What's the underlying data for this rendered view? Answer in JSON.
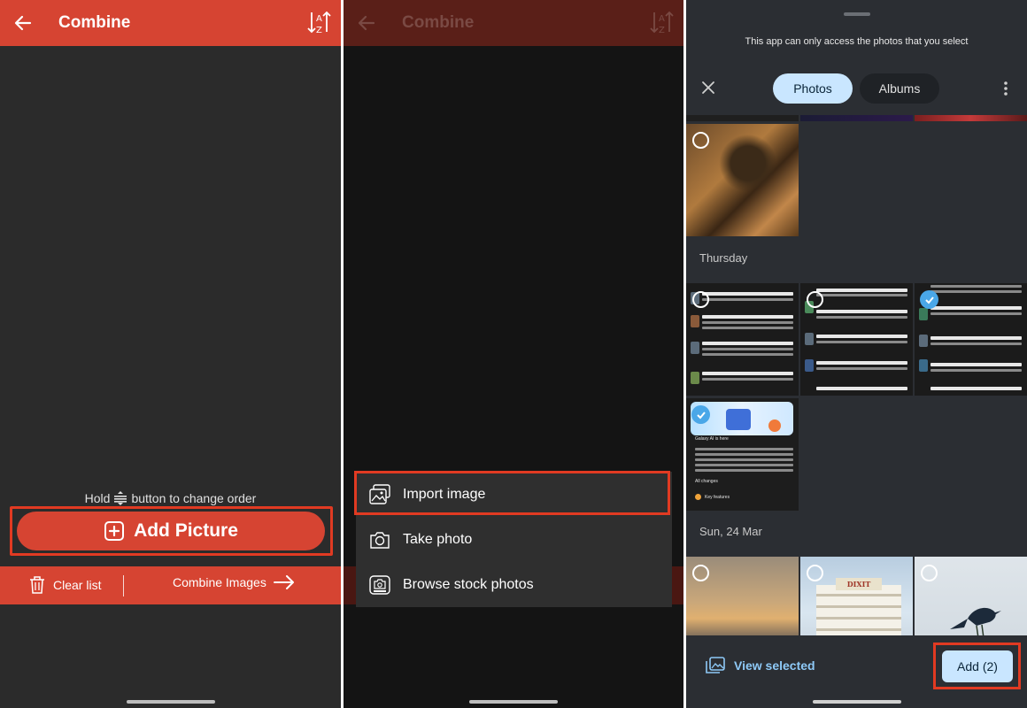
{
  "panel1": {
    "appbar": {
      "title": "Combine"
    },
    "hint": {
      "before": "Hold",
      "after": "button to change order"
    },
    "add_button": {
      "label": "Add Picture"
    },
    "bottom_bar": {
      "clear_label": "Clear list",
      "combine_label": "Combine Images"
    }
  },
  "panel2": {
    "appbar": {
      "title": "Combine"
    },
    "menu": [
      {
        "label": "Import image",
        "icon": "import-image-icon"
      },
      {
        "label": "Take photo",
        "icon": "camera-icon"
      },
      {
        "label": "Browse stock photos",
        "icon": "stock-photos-icon"
      }
    ]
  },
  "panel3": {
    "notice": "This app can only access the photos that you select",
    "tabs": {
      "photos": "Photos",
      "albums": "Albums"
    },
    "dates": {
      "thursday": "Thursday",
      "sun24mar": "Sun, 24 Mar"
    },
    "screenshots": {
      "s1": [
        "Instantly see videos in slow-mo",
        "Move subjects from one image to another",
        "Copy from one image, paste in another",
        "Speed up or slow down parts of videos"
      ],
      "s2": [
        "Editor",
        "Generate your own wallpaper",
        "Extend your battery's lifespan",
        "Voice focus for clearer calls",
        "Customise your alarms"
      ],
      "s3": [
        "Translate phone calls in real time",
        "Get writing help with Writing assist",
        "Translate while chatting",
        "Translate conversations",
        "Auto format note text"
      ],
      "s4": {
        "title": "Galaxy AI is here",
        "changes": "All changes",
        "features": "Key features"
      }
    },
    "building_sign": "DIXIT",
    "footer": {
      "view_selected": "View selected",
      "add_label": "Add (2)"
    }
  },
  "colors": {
    "brand_red": "#d64432",
    "highlight_red": "#e13a22",
    "picker_accent": "#c9e6ff",
    "link_blue": "#8ec9f7"
  }
}
